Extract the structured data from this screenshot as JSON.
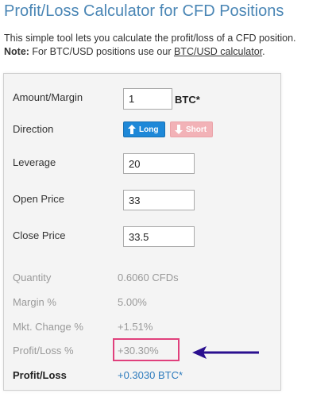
{
  "page": {
    "title": "Profit/Loss Calculator for CFD Positions",
    "intro_text": "This simple tool lets you calculate the profit/loss of a CFD position.",
    "note_label": "Note:",
    "note_text": " For BTC/USD positions use our ",
    "note_link": "BTC/USD calculator",
    "note_end": "."
  },
  "form": {
    "amount_label": "Amount/Margin",
    "amount_value": "1",
    "amount_unit": "BTC*",
    "direction_label": "Direction",
    "long_label": "Long",
    "short_label": "Short",
    "leverage_label": "Leverage",
    "leverage_value": "20",
    "open_label": "Open Price",
    "open_value": "33",
    "close_label": "Close Price",
    "close_value": "33.5"
  },
  "results": {
    "quantity_label": "Quantity",
    "quantity_value": "0.6060 CFDs",
    "margin_label": "Margin %",
    "margin_value": "5.00%",
    "change_label": "Mkt. Change %",
    "change_value": "+1.51%",
    "pl_pct_label": "Profit/Loss %",
    "pl_pct_value": "+30.30%",
    "pl_label": "Profit/Loss",
    "pl_value": "+0.3030 BTC*"
  },
  "colors": {
    "title": "#4a86b5",
    "long_button": "#1e88d8",
    "short_button": "#f2b2b7",
    "highlight_box": "#e0407c",
    "arrow": "#2a0f8f",
    "profit_value": "#2d7bbd"
  },
  "icons": {
    "long": "arrow-up-icon",
    "short": "arrow-down-icon",
    "annotation": "annotation-arrow-icon"
  }
}
